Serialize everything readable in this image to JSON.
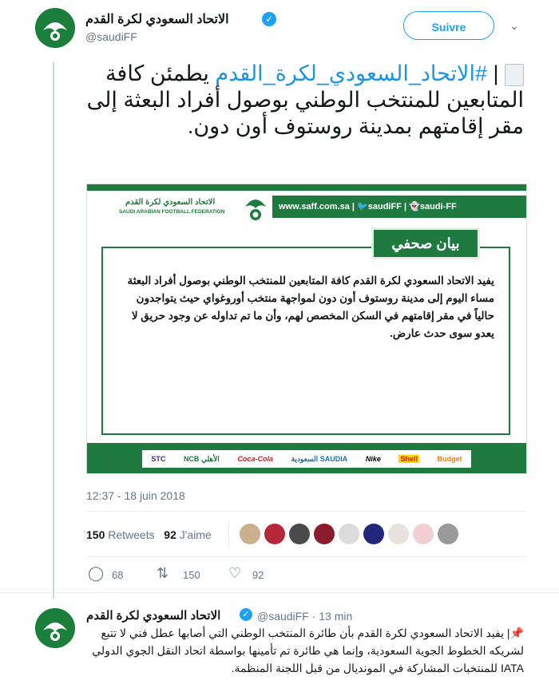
{
  "tweet": {
    "display_name": "الاتحاد السعودي لكرة القدم",
    "handle": "@saudiFF",
    "follow_label": "Suivre",
    "hashtag": "#الاتحاد_السعودي_لكرة_القدم",
    "text_after_hashtag": "يطمئن كافة المتابعين للمنتخب الوطني بوصول أفراد البعثة إلى مقر إقامتهم بمدينة روستوف أون دون.",
    "timestamp": "12:37 - 18 juin 2018",
    "retweets_count": "150",
    "retweets_label": "Retweets",
    "likes_count": "92",
    "likes_label": "J'aime",
    "reply_count": "68",
    "retweet_action_count": "150",
    "like_action_count": "92"
  },
  "card": {
    "site": "www.saff.com.sa",
    "twitter": "saudiFF",
    "snapchat": "saudi-FF",
    "federation_ar": "الاتحاد السعودي لكرة القدم",
    "federation_en": "SAUDI ARABIAN FOOTBALL FEDERATION",
    "tab_title": "بيان صحفي",
    "statement": "يفيد الاتحاد السعودي لكرة القدم كافة المتابعين للمنتخب الوطني بوصول أفراد البعثة مساء اليوم إلى مدينة روستوف أون دون لمواجهة منتخب أوروغواي حيث يتواجدون حالياً في مقر إقامتهم في السكن المخصص لهم، وأن ما تم تداوله عن وجود حريق لا يعدو سوى حدث عارض.",
    "sponsors": [
      "STC",
      "NCB الأهلي",
      "Coca-Cola",
      "السعودية SAUDIA",
      "Nike",
      "Shell",
      "Budget"
    ]
  },
  "reply": {
    "display_name": "الاتحاد السعودي لكرة القدم",
    "handle_time": "@saudiFF · 13 min",
    "text": "📌| يفيد الاتحاد السعودي لكرة القدم بأن طائرة المنتخب الوطني التي أصابها عطل فني لا تتبع لشريكه الخطوط الجوية السعودية، وإنما هي طائرة تم تأمينها بواسطة اتحاد النقل الجوي الدولي IATA للمنتخبات المشاركة في المونديال من قبل اللجنة المنظمة."
  },
  "colors": {
    "accent": "#1da1f2",
    "saff_green": "#1f7a3f",
    "hashtag": "#1b95e0"
  }
}
